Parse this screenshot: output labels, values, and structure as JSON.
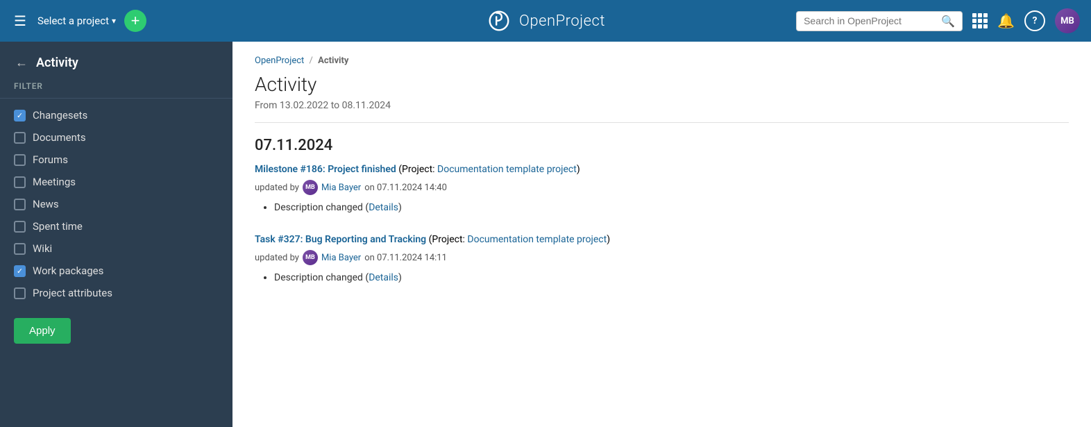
{
  "nav": {
    "hamburger_icon": "☰",
    "project_select_label": "Select a project",
    "project_select_arrow": "▾",
    "add_button_label": "+",
    "logo_text": "OpenProject",
    "search_placeholder": "Search in OpenProject",
    "search_icon": "🔍",
    "help_label": "?",
    "avatar_label": "MB",
    "bell_icon": "🔔"
  },
  "sidebar": {
    "back_arrow": "←",
    "title": "Activity",
    "filter_label": "FILTER",
    "filters": [
      {
        "id": "changesets",
        "label": "Changesets",
        "checked": true
      },
      {
        "id": "documents",
        "label": "Documents",
        "checked": false
      },
      {
        "id": "forums",
        "label": "Forums",
        "checked": false
      },
      {
        "id": "meetings",
        "label": "Meetings",
        "checked": false
      },
      {
        "id": "news",
        "label": "News",
        "checked": false
      },
      {
        "id": "spent-time",
        "label": "Spent time",
        "checked": false
      },
      {
        "id": "wiki",
        "label": "Wiki",
        "checked": false
      },
      {
        "id": "work-packages",
        "label": "Work packages",
        "checked": true
      },
      {
        "id": "project-attributes",
        "label": "Project attributes",
        "checked": false
      }
    ],
    "apply_button": "Apply"
  },
  "main": {
    "breadcrumb": {
      "parent_label": "OpenProject",
      "separator": "/",
      "current": "Activity"
    },
    "page_title": "Activity",
    "date_range": "From 13.02.2022 to 08.11.2024",
    "date_groups": [
      {
        "date": "07.11.2024",
        "items": [
          {
            "title_link_text": "Milestone #186: Project finished",
            "title_middle": " (Project: ",
            "project_link_text": "Documentation template project",
            "title_end": ")",
            "updated_by": "updated by",
            "user_name": "Mia Bayer",
            "timestamp": "on 07.11.2024 14:40",
            "changes": [
              {
                "text": "Description changed ",
                "detail_link": "Details",
                "detail_parens_open": "(",
                "detail_parens_close": ")"
              }
            ]
          },
          {
            "title_link_text": "Task #327: Bug Reporting and Tracking",
            "title_middle": " (Project: ",
            "project_link_text": "Documentation template project",
            "title_end": ")",
            "updated_by": "updated by",
            "user_name": "Mia Bayer",
            "timestamp": "on 07.11.2024 14:11",
            "changes": [
              {
                "text": "Description changed ",
                "detail_link": "Details",
                "detail_parens_open": "(",
                "detail_parens_close": ")"
              }
            ]
          }
        ]
      }
    ]
  }
}
